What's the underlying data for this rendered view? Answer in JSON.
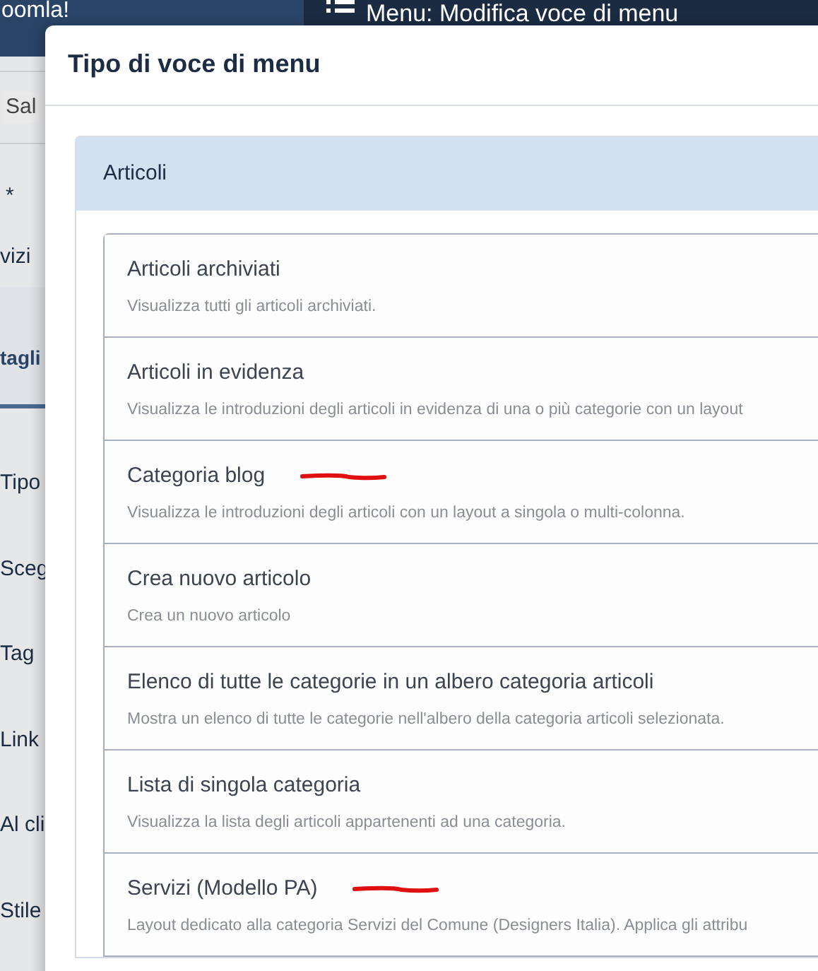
{
  "background": {
    "logo": "oomla!",
    "page_title": "Menu: Modifica voce di menu",
    "toolbar_button": "Sal",
    "labels": [
      {
        "text": "*",
        "kind": "plain"
      },
      {
        "text": "vizi",
        "kind": "plain"
      },
      {
        "text": "tagli",
        "kind": "tab"
      },
      {
        "text": "Tipo",
        "kind": "plain"
      },
      {
        "text": "Sceg",
        "kind": "plain"
      },
      {
        "text": "Tag",
        "kind": "plain"
      },
      {
        "text": "Link",
        "kind": "plain"
      },
      {
        "text": "Al cli",
        "kind": "plain"
      },
      {
        "text": "Stile",
        "kind": "plain"
      }
    ]
  },
  "modal": {
    "title": "Tipo di voce di menu",
    "group": {
      "title": "Articoli",
      "items": [
        {
          "title": "Articoli archiviati",
          "description": "Visualizza tutti gli articoli archiviati.",
          "marked": false
        },
        {
          "title": "Articoli in evidenza",
          "description": "Visualizza le introduzioni degli articoli in evidenza di una o più categorie con un layout",
          "marked": false
        },
        {
          "title": "Categoria blog",
          "description": "Visualizza le introduzioni degli articoli con un layout a singola o multi-colonna.",
          "marked": true
        },
        {
          "title": "Crea nuovo articolo",
          "description": "Crea un nuovo articolo",
          "marked": false
        },
        {
          "title": "Elenco di tutte le categorie in un albero categoria articoli",
          "description": "Mostra un elenco di tutte le categorie nell'albero della categoria articoli selezionata.",
          "marked": false
        },
        {
          "title": "Lista di singola categoria",
          "description": "Visualizza la lista degli articoli appartenenti ad una categoria.",
          "marked": false
        },
        {
          "title": "Servizi (Modello PA)",
          "description": "Layout dedicato alla categoria Servizi del Comune (Designers Italia). Applica gli attribu",
          "marked": true
        }
      ]
    }
  }
}
